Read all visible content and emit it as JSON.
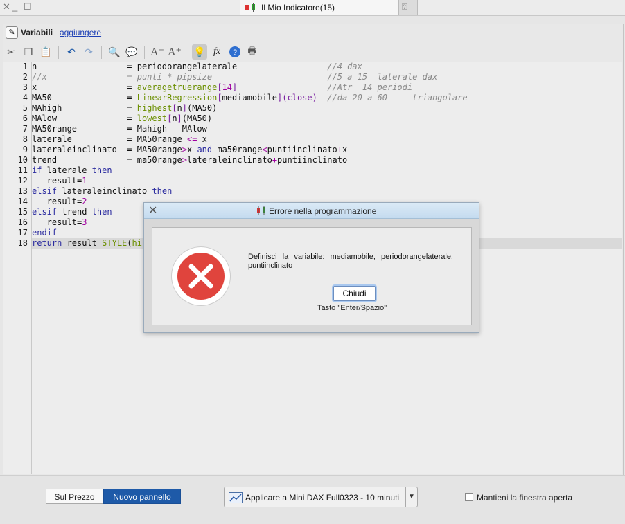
{
  "window": {
    "tab_title": "Il Mio Indicatore(15)"
  },
  "panel": {
    "title": "Variabili",
    "add_link": "aggiungere"
  },
  "editor": {
    "line_numbers": [
      "1",
      "2",
      "3",
      "4",
      "5",
      "6",
      "7",
      "8",
      "9",
      "10",
      "11",
      "12",
      "13",
      "14",
      "15",
      "16",
      "17",
      "18"
    ],
    "lines": [
      "n                  = periodorangelaterale                  //4 dax",
      "//x                = punti * pipsize                       //5 a 15  laterale dax",
      "x                  = averagetruerange[14]                  //Atr  14 periodi",
      "MA50               = LinearRegression[mediamobile](close)  //da 20 a 60     triangolare",
      "MAhigh             = highest[n](MA50)",
      "MAlow              = lowest[n](MA50)",
      "MA50range          = Mahigh - MAlow",
      "laterale           = MA50range <= x",
      "lateraleinclinato  = MA50range>x and ma50range<puntiinclinato+x",
      "trend              = ma50range>lateraleinclinato+puntiinclinato",
      "if laterale then",
      "   result=1",
      "elsif lateraleinclinato then",
      "   result=2",
      "elsif trend then",
      "   result=3",
      "endif",
      "return result STYLE(his"
    ]
  },
  "dialog": {
    "title": "Errore nella programmazione",
    "message": "Definisci la variabile: mediamobile, periodorangelaterale, puntiinclinato",
    "button": "Chiudi",
    "hint": "Tasto \"Enter/Spazio\""
  },
  "bottom": {
    "seg_price": "Sul Prezzo",
    "seg_new": "Nuovo pannello",
    "apply_label": "Applicare a Mini DAX Full0323 - 10 minuti",
    "keep_open": "Mantieni la finestra aperta"
  },
  "colors": {
    "accent": "#1e5aa8",
    "error": "#e0443d",
    "keyword": "#2b2b9f",
    "function": "#6b8f00"
  }
}
